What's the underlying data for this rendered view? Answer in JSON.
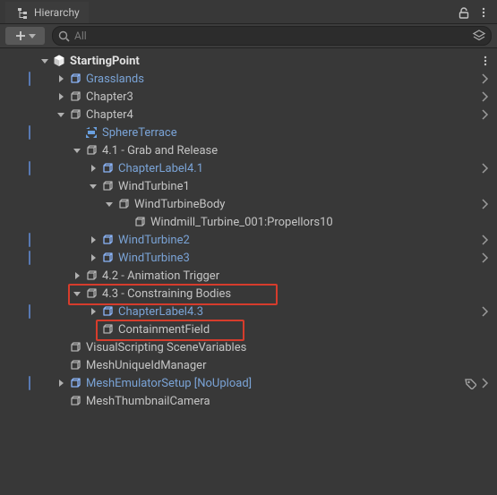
{
  "panel": {
    "title": "Hierarchy"
  },
  "search": {
    "placeholder": "All"
  },
  "scene": {
    "name": "StartingPoint"
  },
  "rows": [
    {
      "id": "grasslands",
      "label": "Grasslands"
    },
    {
      "id": "chapter3",
      "label": "Chapter3"
    },
    {
      "id": "chapter4",
      "label": "Chapter4"
    },
    {
      "id": "sphereterrace",
      "label": "SphereTerrace"
    },
    {
      "id": "sec41",
      "label": "4.1 - Grab and Release"
    },
    {
      "id": "chapterlabel41",
      "label": "ChapterLabel4.1"
    },
    {
      "id": "windturbine1",
      "label": "WindTurbine1"
    },
    {
      "id": "windturbinebody",
      "label": "WindTurbineBody"
    },
    {
      "id": "windmill",
      "label": "Windmill_Turbine_001:Propellors10"
    },
    {
      "id": "windturbine2",
      "label": "WindTurbine2"
    },
    {
      "id": "windturbine3",
      "label": "WindTurbine3"
    },
    {
      "id": "sec42",
      "label": "4.2 - Animation Trigger"
    },
    {
      "id": "sec43",
      "label": "4.3 - Constraining Bodies"
    },
    {
      "id": "chapterlabel43",
      "label": "ChapterLabel4.3"
    },
    {
      "id": "containment",
      "label": "ContainmentField"
    },
    {
      "id": "visualscripting",
      "label": "VisualScripting SceneVariables"
    },
    {
      "id": "meshuniqueid",
      "label": "MeshUniqueIdManager"
    },
    {
      "id": "meshemu",
      "label": "MeshEmulatorSetup [NoUpload]"
    },
    {
      "id": "meshthumb",
      "label": "MeshThumbnailCamera"
    }
  ]
}
